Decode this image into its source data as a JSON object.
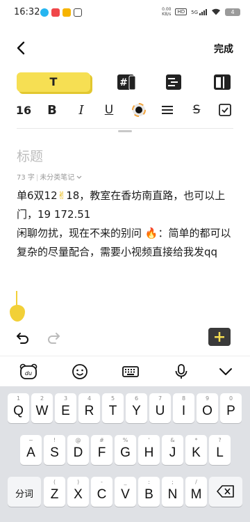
{
  "status_bar": {
    "time": "16:32",
    "network_speed_value": "0.00",
    "network_speed_unit": "KB/s",
    "hd_badge": "HD",
    "signal_label": "5G",
    "battery": "4",
    "notification_icons": [
      "chat-bubble-icon",
      "app-icon",
      "app-icon",
      "app-icon"
    ]
  },
  "header": {
    "done_label": "完成"
  },
  "style_toolbar": {
    "text_style_label": "T",
    "icons": [
      "text-style-icon",
      "hashtag-card-icon",
      "list-card-icon",
      "layout-card-icon"
    ]
  },
  "format_toolbar": {
    "font_size": "16",
    "bold": "B",
    "italic": "I",
    "underline": "U",
    "strike": "S",
    "icons": [
      "font-size",
      "bold",
      "italic",
      "underline",
      "color-picker-icon",
      "align-icon",
      "strikethrough",
      "checkbox-icon"
    ]
  },
  "note": {
    "title_placeholder": "标题",
    "word_count": "73 字",
    "category": "未分类笔记",
    "line1a": "单6双12",
    "line1_emoji": "✌",
    "line1b": "18，教室在香坊南直路，也可以上门，19    172.51",
    "line2a": "闲聊勿扰，现在不来的别问 ",
    "line2_emoji": "🔥",
    "line2b": "：简单的都可以复杂的尽量配合，需要小视频直接给我发qq"
  },
  "edit_bar": {
    "icons": [
      "undo-icon",
      "redo-icon",
      "add-icon"
    ]
  },
  "ime_bar": {
    "icons": [
      "du-bear-icon",
      "emoji-face-icon",
      "keyboard-icon",
      "microphone-icon",
      "chevron-down-icon"
    ]
  },
  "keyboard": {
    "row1": [
      {
        "hint": "1",
        "key": "Q"
      },
      {
        "hint": "2",
        "key": "W"
      },
      {
        "hint": "3",
        "key": "E"
      },
      {
        "hint": "4",
        "key": "R"
      },
      {
        "hint": "5",
        "key": "T"
      },
      {
        "hint": "6",
        "key": "Y"
      },
      {
        "hint": "7",
        "key": "U"
      },
      {
        "hint": "8",
        "key": "I"
      },
      {
        "hint": "9",
        "key": "O"
      },
      {
        "hint": "0",
        "key": "P"
      }
    ],
    "row2": [
      {
        "hint": "~",
        "key": "A"
      },
      {
        "hint": "!",
        "key": "S"
      },
      {
        "hint": "@",
        "key": "D"
      },
      {
        "hint": "#",
        "key": "F"
      },
      {
        "hint": "%",
        "key": "G"
      },
      {
        "hint": "'",
        "key": "H"
      },
      {
        "hint": "&",
        "key": "J"
      },
      {
        "hint": "*",
        "key": "K"
      },
      {
        "hint": "?",
        "key": "L"
      }
    ],
    "row3": [
      {
        "hint": "(",
        "key": "Z"
      },
      {
        "hint": ")",
        "key": "X"
      },
      {
        "hint": "-",
        "key": "C"
      },
      {
        "hint": "_",
        "key": "V"
      },
      {
        "hint": ":",
        "key": "B"
      },
      {
        "hint": ";",
        "key": "N"
      },
      {
        "hint": "/",
        "key": "M"
      }
    ],
    "split_label": "分词"
  },
  "colors": {
    "accent": "#f6df53",
    "accent_shadow": "#e2c72f",
    "keyboard_bg": "#dfe1e5",
    "add_button": "#3a3a3a"
  }
}
